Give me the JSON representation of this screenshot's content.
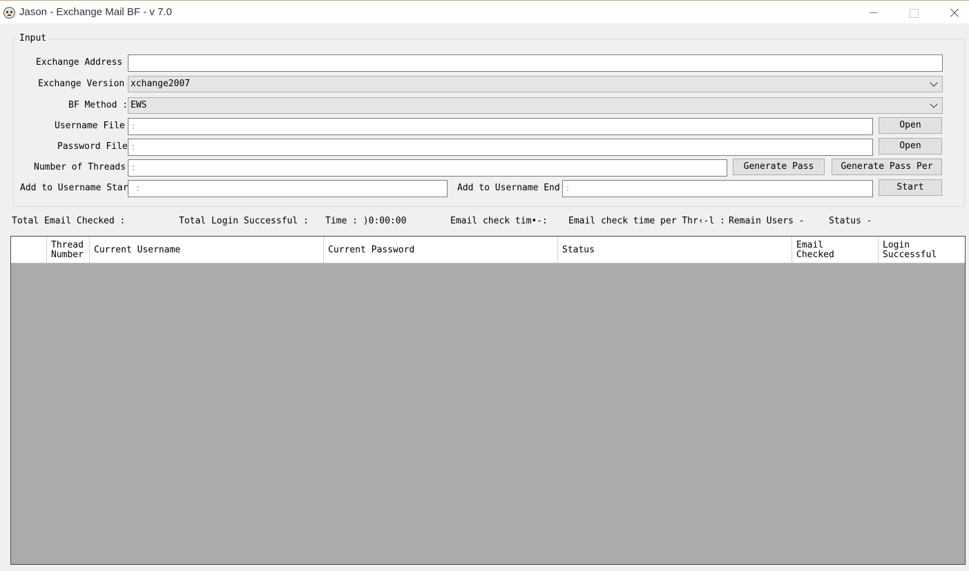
{
  "window": {
    "title": "Jason - Exchange Mail BF - v 7.0"
  },
  "input_group": {
    "legend": "Input",
    "exchange_address": {
      "label": "Exchange Address :",
      "value": ""
    },
    "exchange_version": {
      "label": "Exchange Version :",
      "value": "xchange2007"
    },
    "bf_method": {
      "label": "BF Method :",
      "value": "EWS"
    },
    "username_file": {
      "label": "Username File",
      "value": ":",
      "button": "Open"
    },
    "password_file": {
      "label": "Password File",
      "value": ":",
      "button": "Open"
    },
    "threads": {
      "label": "Number of Threads",
      "value": ":"
    },
    "generate_pass": "Generate Pass",
    "generate_pass_per": "Generate Pass Per",
    "username_start": {
      "label": "Add to Username Start",
      "value": ":"
    },
    "username_end": {
      "label": "Add to Username End",
      "value": ":"
    },
    "start": "Start"
  },
  "stats": {
    "total_email_checked": "Total Email Checked :",
    "total_login_successful": "Total Login Successful :",
    "time": "Time : )0:00:00",
    "email_check_time": "Email check tim•-:",
    "email_check_time_per_thread": "Email check time per Thr‹-l :",
    "remain_users": "Remain Users -",
    "status": "Status -"
  },
  "grid": {
    "columns": [
      "",
      "Thread\nNumber",
      "Current Username",
      "Current Password",
      "Status",
      "Email\nChecked",
      "Login\nSuccessful"
    ]
  }
}
